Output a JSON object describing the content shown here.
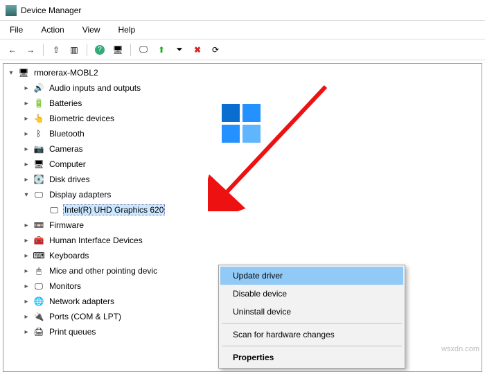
{
  "window": {
    "title": "Device Manager"
  },
  "menu": {
    "file": "File",
    "action": "Action",
    "view": "View",
    "help": "Help"
  },
  "toolbar_icons": {
    "back": "←",
    "forward": "→",
    "up": "⇧",
    "props": "▥",
    "help": "?",
    "scan": "🖥",
    "monitor": "🖵",
    "update": "⬆",
    "disable": "⏷",
    "uninstall": "✖",
    "refresh": "⟳"
  },
  "tree": {
    "root": "rmorerax-MOBL2",
    "nodes": [
      {
        "icon": "🔊",
        "label": "Audio inputs and outputs"
      },
      {
        "icon": "🔋",
        "label": "Batteries"
      },
      {
        "icon": "👆",
        "label": "Biometric devices"
      },
      {
        "icon": "ᛒ",
        "label": "Bluetooth"
      },
      {
        "icon": "📷",
        "label": "Cameras"
      },
      {
        "icon": "🖥",
        "label": "Computer"
      },
      {
        "icon": "💽",
        "label": "Disk drives"
      },
      {
        "icon": "🖵",
        "label": "Display adapters",
        "expanded": true,
        "children": [
          {
            "icon": "🖵",
            "label": "Intel(R) UHD Graphics 620",
            "selected": true
          }
        ]
      },
      {
        "icon": "📼",
        "label": "Firmware"
      },
      {
        "icon": "🧰",
        "label": "Human Interface Devices"
      },
      {
        "icon": "⌨",
        "label": "Keyboards"
      },
      {
        "icon": "🖱",
        "label": "Mice and other pointing devic"
      },
      {
        "icon": "🖵",
        "label": "Monitors"
      },
      {
        "icon": "🌐",
        "label": "Network adapters"
      },
      {
        "icon": "🔌",
        "label": "Ports (COM & LPT)"
      },
      {
        "icon": "🖨",
        "label": "Print queues"
      }
    ]
  },
  "context_menu": {
    "items": [
      {
        "label": "Update driver",
        "highlight": true
      },
      {
        "label": "Disable device"
      },
      {
        "label": "Uninstall device"
      },
      {
        "sep": true
      },
      {
        "label": "Scan for hardware changes"
      },
      {
        "sep": true
      },
      {
        "label": "Properties",
        "bold": true
      }
    ]
  },
  "watermark": "wsxdn.com"
}
